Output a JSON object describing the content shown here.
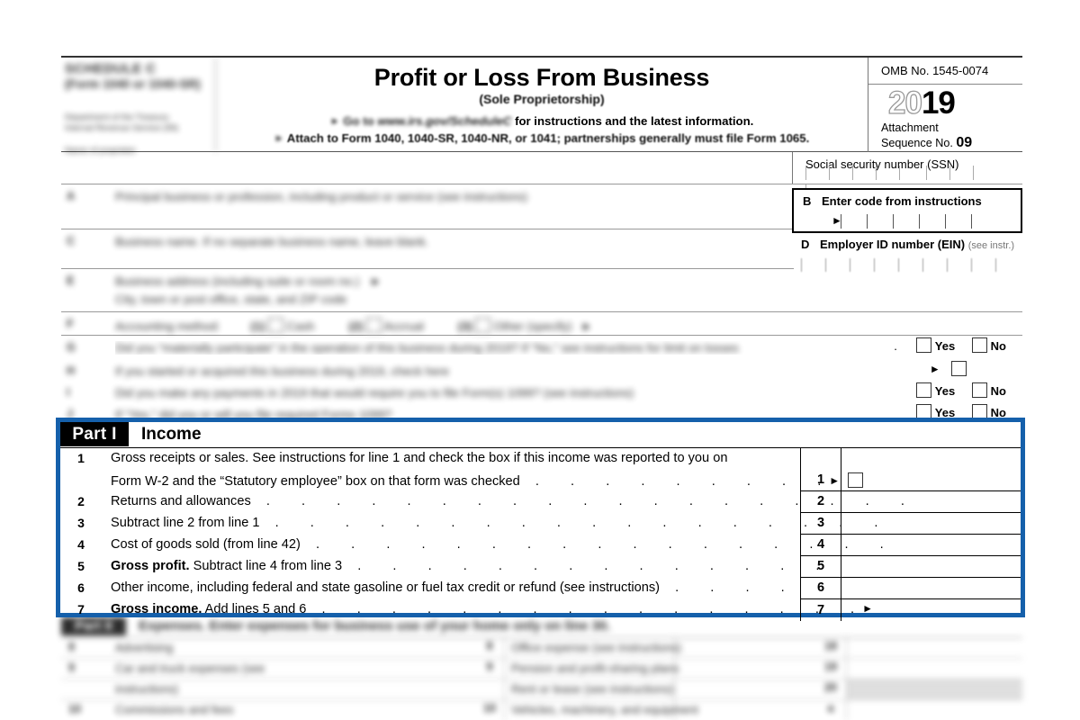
{
  "document": {
    "schedule_label": "SCHEDULE C",
    "schedule_sub": "(Form 1040 or 1040-SR)",
    "dept_line1": "Department of the Treasury",
    "dept_line2": "Internal Revenue Service (99)",
    "name_label": "Name of proprietor",
    "title": "Profit or Loss From Business",
    "subtitle": "(Sole Proprietorship)",
    "go_to_prefix": "Go to",
    "go_to_url": "www.irs.gov/ScheduleC",
    "go_to_suffix": "for instructions and the latest information.",
    "attach_text": "Attach to Form 1040, 1040-SR, 1040-NR, or 1041; partnerships generally must file Form 1065.",
    "omb": "OMB No. 1545-0074",
    "year_outline": "20",
    "year_bold": "19",
    "attachment_label": "Attachment",
    "sequence_label": "Sequence No.",
    "sequence_no": "09"
  },
  "identity": {
    "ssn_label": "Social security number (SSN)",
    "rows": [
      {
        "letter": "A",
        "text": "Principal business or profession, including product or service (see instructions)",
        "right_letter": "B",
        "right_label": "Enter code from instructions"
      },
      {
        "letter": "C",
        "text": "Business name. If no separate business name, leave blank.",
        "right_letter": "D",
        "right_label": "Employer ID number (EIN)",
        "right_label_small": "(see instr.)"
      },
      {
        "letter": "E",
        "text": "Business address (including suite or room no.)",
        "text2": "City, town or post office, state, and ZIP code"
      },
      {
        "letter": "F",
        "text": "Accounting method:",
        "options": [
          "Cash",
          "Accrual",
          "Other (specify)"
        ]
      },
      {
        "letter": "G",
        "text": "Did you “materially participate” in the operation of this business during 2019? If “No,” see instructions for limit on losses",
        "yes": "Yes",
        "no": "No"
      },
      {
        "letter": "H",
        "text": "If you started or acquired this business during 2019, check here"
      },
      {
        "letter": "I",
        "text": "Did you make any payments in 2019 that would require you to file Form(s) 1099? (see instructions)",
        "yes": "Yes",
        "no": "No"
      },
      {
        "letter": "J",
        "text": "If “Yes,” did you or will you file required Forms 1099?",
        "yes": "Yes",
        "no": "No"
      }
    ]
  },
  "part1": {
    "badge": "Part I",
    "name": "Income",
    "lines": [
      {
        "no": "1",
        "text": "Gross receipts or sales. See instructions for line 1 and check the box if this income was reported to you on",
        "text2": "Form W-2 and the “Statutory employee” box on that form was checked",
        "has_checkbox": true,
        "box_no": "1",
        "value": ""
      },
      {
        "no": "2",
        "text": "Returns and allowances",
        "box_no": "2",
        "value": ""
      },
      {
        "no": "3",
        "text": "Subtract line 2 from line 1",
        "box_no": "3",
        "value": ""
      },
      {
        "no": "4",
        "text": "Cost of goods sold (from line 42)",
        "box_no": "4",
        "value": ""
      },
      {
        "no": "5",
        "bold_prefix": "Gross profit.",
        "text": "Subtract line 4 from line 3",
        "box_no": "5",
        "value": ""
      },
      {
        "no": "6",
        "text": "Other income, including federal and state gasoline or fuel tax credit or refund (see instructions)",
        "box_no": "6",
        "value": ""
      },
      {
        "no": "7",
        "bold_prefix": "Gross income.",
        "text": "Add lines 5 and 6",
        "box_no": "7",
        "value": ""
      }
    ]
  },
  "part2": {
    "badge": "Part II",
    "name": "Expenses. Enter expenses for business use of your home only on line 30.",
    "rows": [
      {
        "no": "8",
        "text": "Advertising",
        "box_no": "8",
        "no2": "18",
        "text2": "Office expense (see instructions)"
      },
      {
        "no": "9",
        "text": "Car and truck expenses (see",
        "box_no": "9",
        "no2": "19",
        "text2": "Pension and profit-sharing plans"
      },
      {
        "no": "",
        "text": "instructions)",
        "box_no": "",
        "no2": "20",
        "text2": "Rent or lease (see instructions):"
      },
      {
        "no": "10",
        "text": "Commissions and fees",
        "box_no": "10",
        "no2": "a",
        "text2": "Vehicles, machinery, and equipment"
      }
    ]
  },
  "colors": {
    "highlight_blue": "#1560ab",
    "badge_black": "#000000",
    "paper": "#ffffff"
  }
}
